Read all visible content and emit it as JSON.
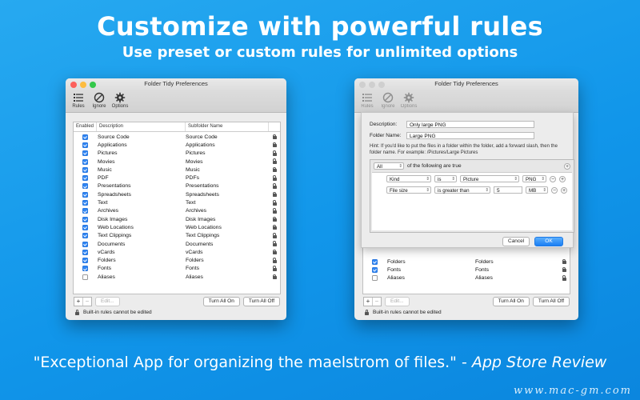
{
  "hero": {
    "headline": "Customize with powerful rules",
    "subheadline": "Use preset or custom rules for unlimited options",
    "quote": "\"Exceptional App for organizing the maelstrom of files.\" - ",
    "quote_source": "App Store Review",
    "watermark": "www.mac-gm.com"
  },
  "window": {
    "title": "Folder Tidy Preferences",
    "toolbar": [
      "Rules",
      "Ignore",
      "Options"
    ],
    "columns": [
      "Enabled",
      "Description",
      "Subfolder Name"
    ],
    "rules": [
      {
        "enabled": true,
        "description": "Source Code",
        "subfolder": "Source Code"
      },
      {
        "enabled": true,
        "description": "Applications",
        "subfolder": "Applications"
      },
      {
        "enabled": true,
        "description": "Pictures",
        "subfolder": "Pictures"
      },
      {
        "enabled": true,
        "description": "Movies",
        "subfolder": "Movies"
      },
      {
        "enabled": true,
        "description": "Music",
        "subfolder": "Music"
      },
      {
        "enabled": true,
        "description": "PDF",
        "subfolder": "PDFs"
      },
      {
        "enabled": true,
        "description": "Presentations",
        "subfolder": "Presentations"
      },
      {
        "enabled": true,
        "description": "Spreadsheets",
        "subfolder": "Spreadsheets"
      },
      {
        "enabled": true,
        "description": "Text",
        "subfolder": "Text"
      },
      {
        "enabled": true,
        "description": "Archives",
        "subfolder": "Archives"
      },
      {
        "enabled": true,
        "description": "Disk Images",
        "subfolder": "Disk Images"
      },
      {
        "enabled": true,
        "description": "Web Locations",
        "subfolder": "Web Locations"
      },
      {
        "enabled": true,
        "description": "Text Clippings",
        "subfolder": "Text Clippings"
      },
      {
        "enabled": true,
        "description": "Documents",
        "subfolder": "Documents"
      },
      {
        "enabled": true,
        "description": "vCards",
        "subfolder": "vCards"
      },
      {
        "enabled": true,
        "description": "Folders",
        "subfolder": "Folders"
      },
      {
        "enabled": true,
        "description": "Fonts",
        "subfolder": "Fonts"
      },
      {
        "enabled": false,
        "description": "Aliases",
        "subfolder": "Aliases"
      }
    ],
    "buttons": {
      "add": "+",
      "remove": "−",
      "edit": "Edit...",
      "turn_all_on": "Turn All On",
      "turn_all_off": "Turn All Off"
    },
    "footer_note": "Built-in rules cannot be edited"
  },
  "rule_sheet": {
    "description_label": "Description:",
    "description_value": "Only large PNG",
    "folder_label": "Folder Name:",
    "folder_value": "Large PNG",
    "hint": "Hint: If you'd like to put the files in a folder within the folder, add a forward slash, then the folder name.  For example: /Pictures/Large Pictures",
    "match_mode": "All",
    "match_text": "of the following are true",
    "criteria": [
      {
        "attribute": "Kind",
        "operator": "is",
        "value": "Picture",
        "extra": "PNG",
        "input": ""
      },
      {
        "attribute": "File size",
        "operator": "is greater than",
        "value": "",
        "extra": "MB",
        "input": "5"
      }
    ],
    "cancel": "Cancel",
    "ok": "OK",
    "visible_rules": [
      {
        "enabled": true,
        "description": "Folders",
        "subfolder": "Folders"
      },
      {
        "enabled": true,
        "description": "Fonts",
        "subfolder": "Fonts"
      },
      {
        "enabled": false,
        "description": "Aliases",
        "subfolder": "Aliases"
      }
    ]
  }
}
